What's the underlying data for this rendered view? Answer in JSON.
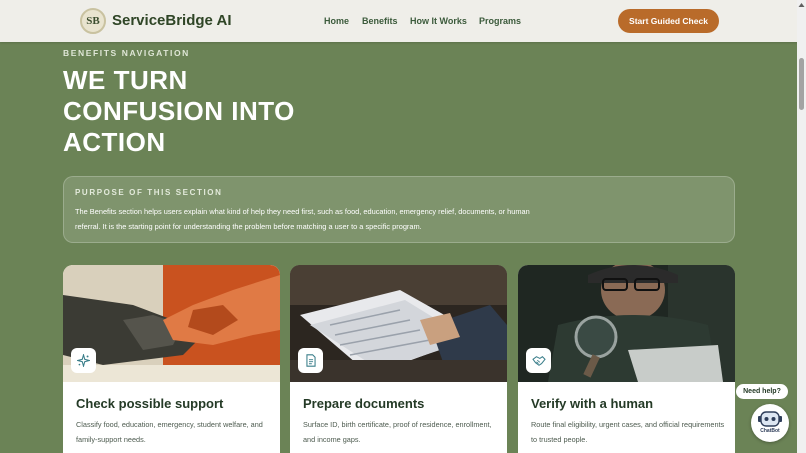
{
  "header": {
    "logo_text": "SB",
    "brand": "ServiceBridge AI",
    "nav": [
      {
        "label": "Home"
      },
      {
        "label": "Benefits"
      },
      {
        "label": "How It Works"
      },
      {
        "label": "Programs"
      }
    ],
    "cta_label": "Start Guided Check"
  },
  "hero": {
    "eyebrow": "BENEFITS NAVIGATION",
    "headline": "WE TURN CONFUSION INTO ACTION"
  },
  "purpose": {
    "title": "PURPOSE OF THIS SECTION",
    "text": "The Benefits section helps users explain what kind of help they need first, such as food, education, emergency relief, documents, or human referral. It is the starting point for understanding the problem before matching a user to a specific program."
  },
  "cards": [
    {
      "icon": "sparkle-icon",
      "title": "Check possible support",
      "desc": "Classify food, education, emergency, student welfare, and family-support needs."
    },
    {
      "icon": "document-icon",
      "title": "Prepare documents",
      "desc": "Surface ID, birth certificate, proof of residence, enrollment, and income gaps."
    },
    {
      "icon": "handshake-icon",
      "title": "Verify with a human",
      "desc": "Route final eligibility, urgent cases, and official requirements to trusted people."
    }
  ],
  "chat": {
    "help_label": "Need help?",
    "bot_label": "ChatBot"
  },
  "colors": {
    "background": "#6b8356",
    "nav_bg": "#efeee9",
    "accent": "#b96b2a",
    "heading_dark": "#243a26"
  }
}
